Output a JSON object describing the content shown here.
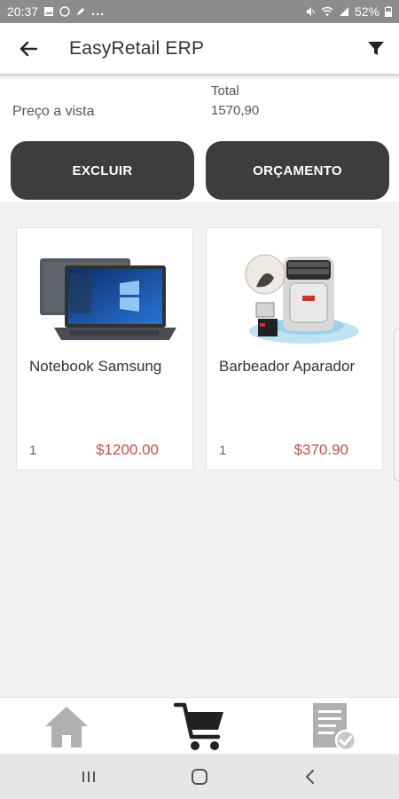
{
  "status_bar": {
    "time": "20:37",
    "battery": "52%"
  },
  "app_bar": {
    "title": "EasyRetail ERP"
  },
  "summary": {
    "price_label": "Preço a vista",
    "total_label": "Total",
    "total_value": "1570,90",
    "delete_label": "EXCLUIR",
    "quote_label": "ORÇAMENTO"
  },
  "products": [
    {
      "name": "Notebook Samsung",
      "qty": "1",
      "price": "$1200.00"
    },
    {
      "name": "Barbeador Aparador",
      "qty": "1",
      "price": "$370.90"
    }
  ],
  "icons": {
    "back": "back-arrow-icon",
    "filter": "filter-icon",
    "home": "home-icon",
    "cart": "cart-icon",
    "orders": "receipt-check-icon"
  },
  "colors": {
    "button_bg": "#3d3d3d",
    "price": "#c0504d",
    "nav_active": "#222222",
    "nav_inactive": "#b0b0b0"
  }
}
